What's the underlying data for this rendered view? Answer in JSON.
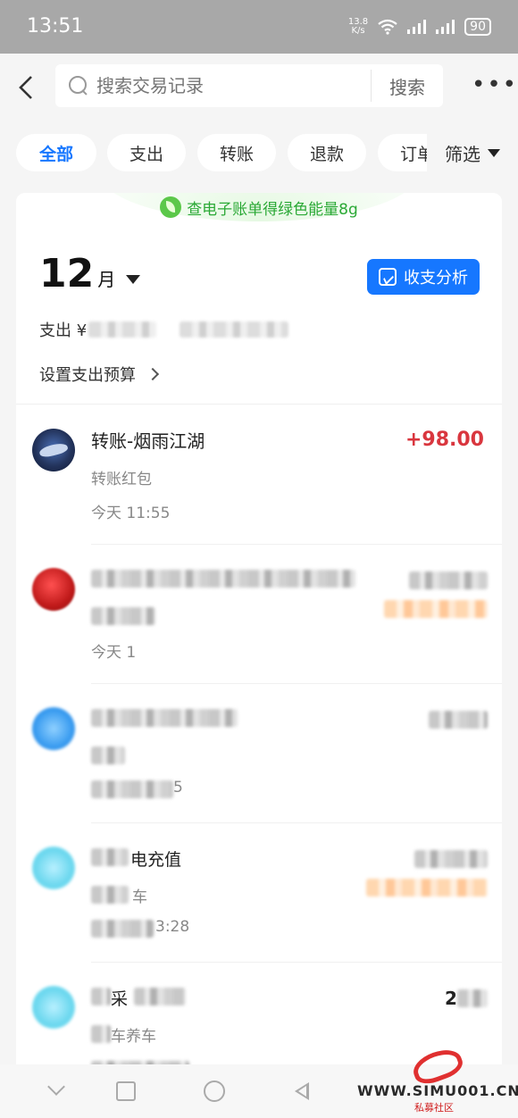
{
  "status_bar": {
    "time": "13:51",
    "net_speed_value": "13.8",
    "net_speed_unit": "K/s",
    "battery": "90"
  },
  "search": {
    "placeholder": "搜索交易记录",
    "button_label": "搜索"
  },
  "chips": [
    {
      "label": "全部",
      "active": true
    },
    {
      "label": "支出",
      "active": false
    },
    {
      "label": "转账",
      "active": false
    },
    {
      "label": "退款",
      "active": false
    },
    {
      "label": "订单",
      "active": false
    }
  ],
  "filter_label": "筛选",
  "eco_banner": {
    "badge": "能量",
    "text": "查电子账单得绿色能量8g"
  },
  "summary": {
    "month": "12",
    "month_unit": "月",
    "analysis_button": "收支分析",
    "expense_prefix": "支出 ¥",
    "budget_link": "设置支出预算"
  },
  "transactions": [
    {
      "title": "转账-烟雨江湖",
      "subtitle": "转账红包",
      "time": "今天 11:55",
      "amount": "+98.00",
      "amount_color": "#d9363e"
    },
    {
      "title": "",
      "subtitle": "",
      "time": "今天 1",
      "amount": "",
      "blurred": true
    },
    {
      "title": "",
      "subtitle": "",
      "time": "5",
      "amount": "",
      "blurred": true
    },
    {
      "title": "电充值",
      "subtitle": "车",
      "time": "3:28",
      "amount": "",
      "blurred": true
    },
    {
      "title": "采",
      "subtitle": "车养车",
      "time": "",
      "amount": "2",
      "blurred": true
    }
  ],
  "watermark": {
    "site": "WWW.SIMU001.CN",
    "sub": "私募社区"
  }
}
